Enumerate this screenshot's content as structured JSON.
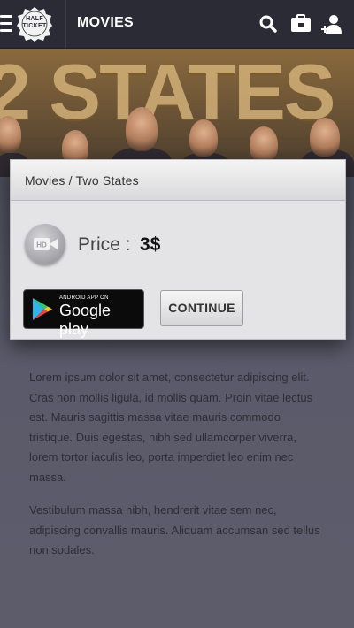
{
  "header": {
    "logo_line1": "HALF",
    "logo_line2": "TICKET",
    "title": "MOVIES",
    "icons": [
      "menu-icon",
      "search-icon",
      "ticket-wallet-icon",
      "user-add-icon"
    ]
  },
  "banner": {
    "movie_title_art": "2 STATES"
  },
  "modal": {
    "breadcrumb": "Movies / Two States",
    "icon": "hd-video-icon",
    "icon_label": "HD",
    "price_label": "Price :",
    "price_value": "3$",
    "store_small_text": "ANDROID APP ON",
    "store_large_text": "Google play",
    "continue_label": "CONTINUE"
  },
  "content": {
    "paragraph1": "Lorem ipsum dolor sit amet, consectetur adipiscing elit. Cras non mollis ligula, id mollis quam. Proin vitae lectus est. Mauris sagittis massa vitae mauris commodo tristique. Duis egestas, nibh sed ullamcorper viverra, lorem tortor iaculis leo, porta imperdiet leo enim nec massa.",
    "paragraph2": "Vestibulum massa nibh, hendrerit vitae sem nec, adipiscing convallis mauris. Aliquam accumsan sed tellus non sodales."
  },
  "colors": {
    "topbar": "#2b2b36",
    "page_background": "#545465",
    "modal_background": "#e4e4e6"
  }
}
